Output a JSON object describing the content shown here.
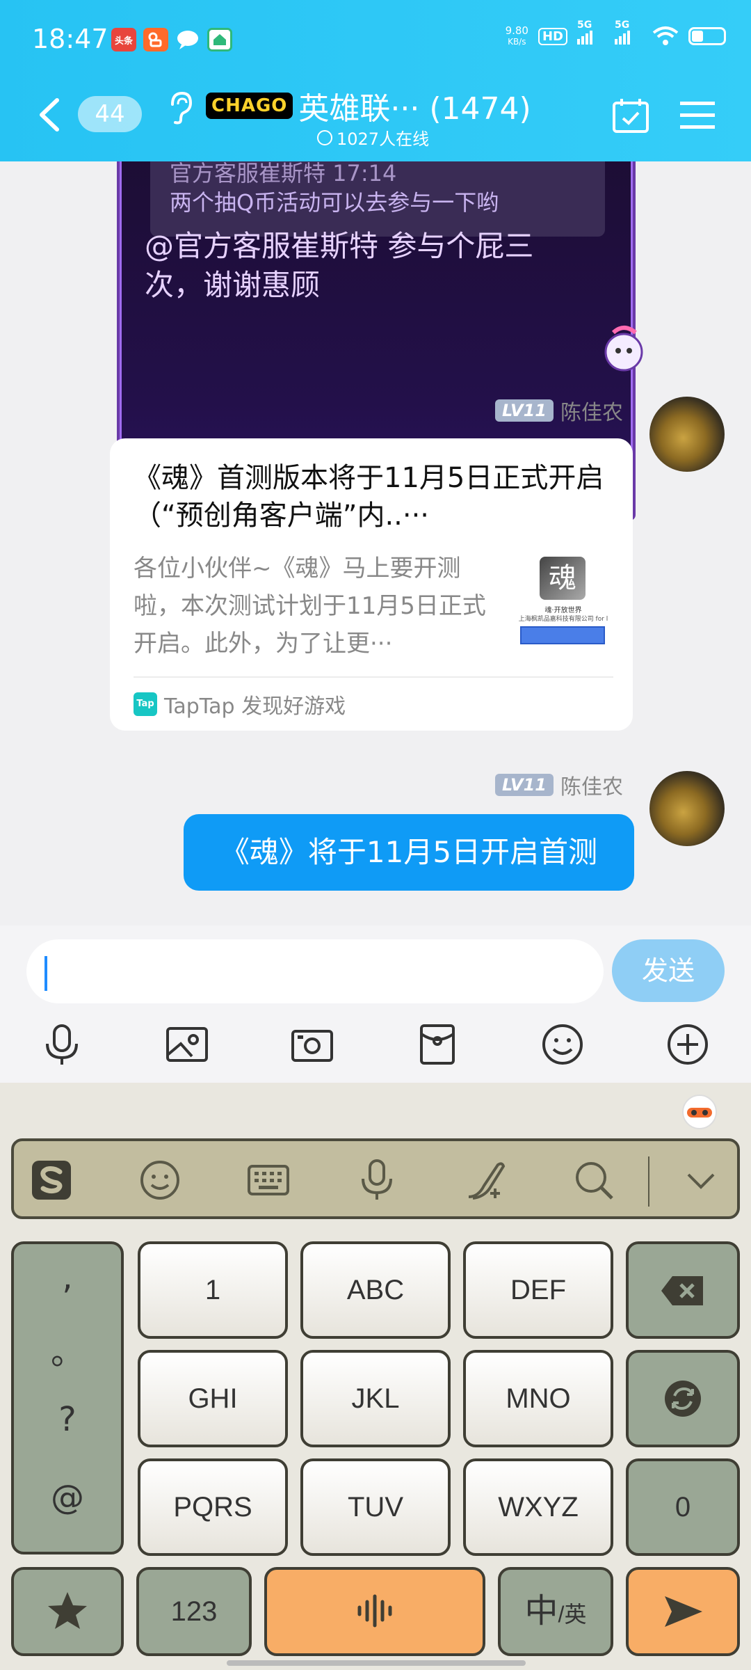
{
  "status_bar": {
    "time": "18:47",
    "notifications": [
      "头条",
      "快手",
      "消息",
      "Vlog"
    ],
    "net_speed_top": "9.80",
    "net_speed_bottom": "KB/s",
    "hd": "HD",
    "signal1": "5G",
    "signal2": "5G"
  },
  "header": {
    "back_badge": "44",
    "game_logo": "CHAGO",
    "title": "英雄联··· (1474)",
    "online": "1027人在线"
  },
  "chat": {
    "quoted": {
      "top_line": "官方客服崔斯特 17:14",
      "text": "两个抽Q币活动可以去参与一下哟"
    },
    "reply": "@官方客服崔斯特 参与个屁三次，谢谢惠顾",
    "messages": [
      {
        "level": "LV11",
        "sender": "陈佳农",
        "card": {
          "title": "《魂》首测版本将于11月5日正式开启（“预创角客户端”内..···",
          "desc": "各位小伙伴~《魂》马上要开测啦，本次测试计划于11月5日正式开启。此外，为了让更···",
          "thumb_line1": "魂·开放世界",
          "thumb_line2": "上海枫凯品嘉科技有限公司 for l",
          "thumb_logo": "魂",
          "source": "TapTap 发现好游戏",
          "source_logo": "Tap"
        }
      },
      {
        "level": "LV11",
        "sender": "陈佳农",
        "text": "《魂》将于11月5日开启首测"
      }
    ]
  },
  "composer": {
    "input_value": "",
    "send_label": "发送"
  },
  "keyboard": {
    "punct": [
      ",",
      "。",
      "?",
      "@"
    ],
    "row1": [
      "1",
      "ABC",
      "DEF"
    ],
    "row2": [
      "GHI",
      "JKL",
      "MNO"
    ],
    "row3": [
      "PQRS",
      "TUV",
      "WXYZ"
    ],
    "zero": "0",
    "key_123": "123",
    "lang_main": "中",
    "lang_sub": "/英"
  }
}
